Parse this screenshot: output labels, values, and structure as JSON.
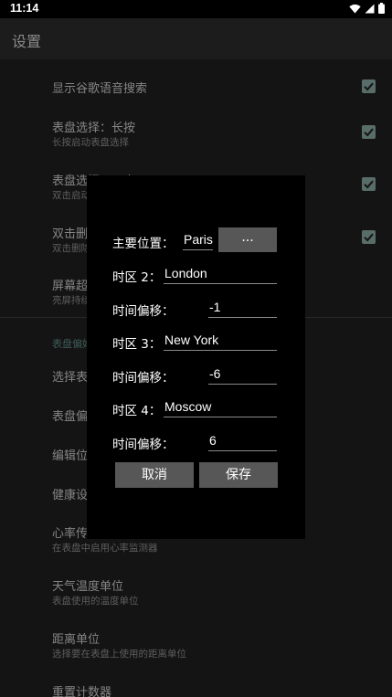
{
  "status": {
    "time": "11:14"
  },
  "appbar": {
    "title": "设置"
  },
  "settings": {
    "voice_search": {
      "title": "显示谷歌语音搜索"
    },
    "watchface_long_press": {
      "title": "表盘选择：长按",
      "subtitle": "长按启动表盘选择"
    },
    "watchface_double_tap": {
      "title": "表盘选择：双击",
      "subtitle": "双击启动表盘选择"
    },
    "double_tap_delete": {
      "title": "双击删除",
      "subtitle": "双击删除"
    },
    "screen_timeout": {
      "title": "屏幕超时",
      "subtitle": "亮屏持续时间"
    },
    "section_watchface": "表盘偏好",
    "select_watchface": {
      "title": "选择表盘"
    },
    "watchface_prefs": {
      "title": "表盘偏好"
    },
    "edit_position": {
      "title": "编辑位置"
    },
    "health_settings": {
      "title": "健康设置"
    },
    "heart_rate": {
      "title": "心率传感器",
      "subtitle": "在表盘中启用心率监测器"
    },
    "temp_unit": {
      "title": "天气温度单位",
      "subtitle": "表盘使用的温度单位"
    },
    "distance_unit": {
      "title": "距离单位",
      "subtitle": "选择要在表盘上使用的距离单位"
    },
    "reset_counter": {
      "title": "重置计数器"
    }
  },
  "dialog": {
    "main_location_label": "主要位置：",
    "main_location_value": "Paris",
    "browse_label": "...",
    "tz2_label": "时区 2：",
    "tz2_value": "London",
    "offset_label": "时间偏移：",
    "tz2_offset": "-1",
    "tz3_label": "时区 3：",
    "tz3_value": "New York",
    "tz3_offset": "-6",
    "tz4_label": "时区 4：",
    "tz4_value": "Moscow",
    "tz4_offset": "6",
    "cancel_label": "取消",
    "save_label": "保存"
  },
  "colors": {
    "checkbox": "#586c68",
    "accent": "#3d5c57",
    "button": "#575757"
  }
}
